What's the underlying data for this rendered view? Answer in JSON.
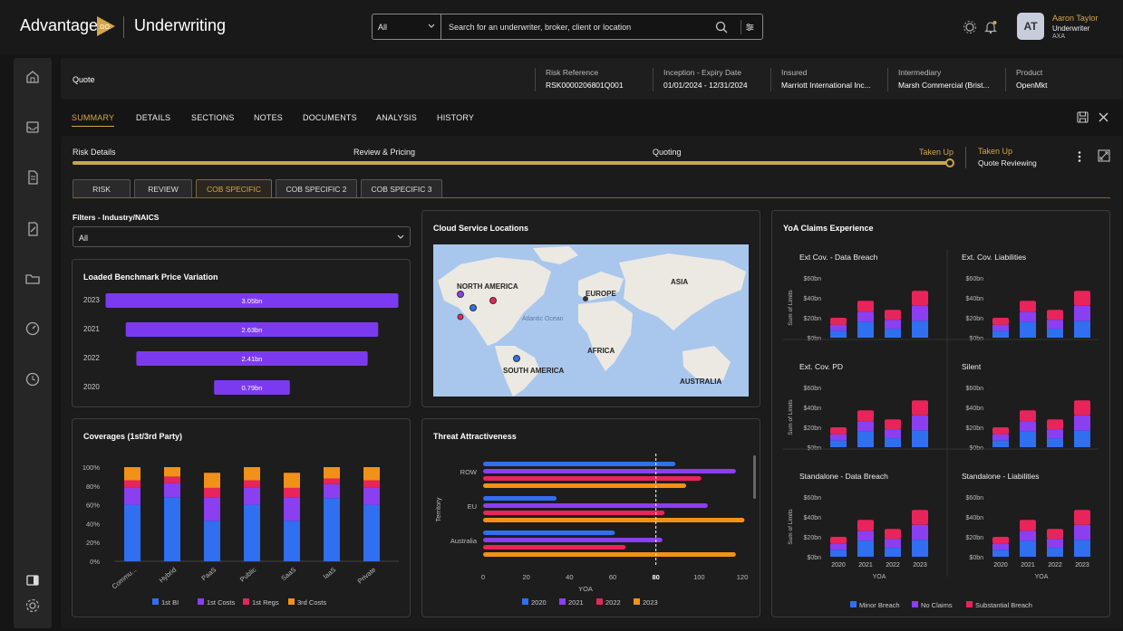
{
  "app": {
    "logo": "Advantage",
    "logo_mark": "GO",
    "name": "Underwriting"
  },
  "search": {
    "scope": "All",
    "placeholder": "Search for an underwriter, broker, client or location"
  },
  "user": {
    "initials": "AT",
    "name": "Aaron Taylor",
    "role": "Underwriter",
    "org": "AXA"
  },
  "header": {
    "page": "Quote",
    "fields": [
      {
        "label": "Risk Reference",
        "value": "RSK0000206801Q001"
      },
      {
        "label": "Inception - Expiry Date",
        "value": "01/01/2024 - 12/31/2024"
      },
      {
        "label": "Insured",
        "value": "Marriott International Inc..."
      },
      {
        "label": "Intermediary",
        "value": "Marsh Commercial (Brist..."
      },
      {
        "label": "Product",
        "value": "OpenMkt"
      }
    ]
  },
  "tabs": [
    "SUMMARY",
    "DETAILS",
    "SECTIONS",
    "NOTES",
    "DOCUMENTS",
    "ANALYSIS",
    "HISTORY"
  ],
  "stages": [
    "Risk Details",
    "Review & Pricing",
    "Quoting",
    "Taken Up"
  ],
  "status": {
    "label": "Taken Up",
    "value": "Quote Reviewing"
  },
  "subtabs": [
    "RISK",
    "REVIEW",
    "COB SPECIFIC",
    "COB SPECIFIC 2",
    "COB SPECIFIC 3"
  ],
  "filter": {
    "label": "Filters - Industry/NAICS",
    "value": "All"
  },
  "colors": {
    "accent": "#d4a64a",
    "blue": "#2f6ff0",
    "purple": "#8a3ff0",
    "red": "#e8245a",
    "orange": "#f29118",
    "bar": "#7c3af0"
  },
  "benchmark": {
    "title": "Loaded Benchmark Price Variation",
    "chart_data": {
      "type": "bar",
      "orientation": "horizontal",
      "categories": [
        "2023",
        "2021",
        "2022",
        "2020"
      ],
      "labels": [
        "3.05bn",
        "2.63bn",
        "2.41bn",
        "0.79bn"
      ],
      "values": [
        3.05,
        2.63,
        2.41,
        0.79
      ]
    }
  },
  "map": {
    "title": "Cloud Service Locations",
    "labels": [
      "NORTH AMERICA",
      "EUROPE",
      "ASIA",
      "Atlantic Ocean",
      "AFRICA",
      "SOUTH AMERICA",
      "AUSTRALIA"
    ]
  },
  "coverages": {
    "title": "Coverages (1st/3rd Party)",
    "chart_data": {
      "type": "bar",
      "stacked": true,
      "categories": [
        "Commu...",
        "Hybrid",
        "PaaS",
        "Public",
        "SaaS",
        "IaaS",
        "Private"
      ],
      "yticks": [
        "100%",
        "80%",
        "60%",
        "40%",
        "20%",
        "0%"
      ],
      "series": [
        {
          "name": "1st BI",
          "values": [
            60,
            68,
            43,
            60,
            43,
            67,
            60
          ]
        },
        {
          "name": "1st Costs",
          "values": [
            18,
            15,
            25,
            18,
            25,
            15,
            18
          ]
        },
        {
          "name": "1st Regs",
          "values": [
            8,
            7,
            10,
            8,
            10,
            6,
            8
          ]
        },
        {
          "name": "3rd Costs",
          "values": [
            14,
            10,
            16,
            14,
            16,
            12,
            14
          ]
        }
      ]
    }
  },
  "threat": {
    "title": "Threat Attractiveness",
    "chart_data": {
      "type": "bar",
      "orientation": "horizontal",
      "categories": [
        "ROW",
        "EU",
        "Australia"
      ],
      "xlabel": "YOA",
      "ylabel": "Territory",
      "xlim": [
        0,
        120
      ],
      "xticks": [
        "0",
        "20",
        "40",
        "60",
        "80",
        "100",
        "120"
      ],
      "marker_label": "80",
      "series": [
        {
          "name": "2020",
          "values": [
            89,
            34,
            61
          ]
        },
        {
          "name": "2021",
          "values": [
            117,
            104,
            83
          ]
        },
        {
          "name": "2022",
          "values": [
            101,
            84,
            66
          ]
        },
        {
          "name": "2023",
          "values": [
            94,
            121,
            117
          ]
        }
      ]
    }
  },
  "claims": {
    "title": "YoA Claims Experience",
    "yticks": [
      "$60bn",
      "$40bn",
      "$20bn",
      "$0bn"
    ],
    "ylabel": "Sum of Limits",
    "xaxis": "YOA",
    "legend": [
      "Minor Breach",
      "No Claims",
      "Substantial Breach"
    ],
    "chart_data": {
      "type": "bar",
      "stacked": true,
      "categories": [
        "2020",
        "2021",
        "2022",
        "2023"
      ],
      "panels": [
        {
          "title": "Ext Cov. - Data Breach",
          "minor": [
            7,
            16,
            9,
            17
          ],
          "noclaims": [
            6,
            10,
            9,
            15
          ],
          "substantial": [
            7,
            11,
            10,
            15
          ]
        },
        {
          "title": "Ext. Cov. Liabilities",
          "minor": [
            7,
            16,
            9,
            17
          ],
          "noclaims": [
            6,
            10,
            9,
            15
          ],
          "substantial": [
            7,
            11,
            10,
            15
          ]
        },
        {
          "title": "Ext. Cov. PD",
          "minor": [
            7,
            16,
            9,
            17
          ],
          "noclaims": [
            6,
            10,
            9,
            15
          ],
          "substantial": [
            7,
            11,
            10,
            15
          ]
        },
        {
          "title": "Silent",
          "minor": [
            7,
            16,
            9,
            17
          ],
          "noclaims": [
            6,
            10,
            9,
            15
          ],
          "substantial": [
            7,
            11,
            10,
            15
          ]
        },
        {
          "title": "Standalone - Data Breach",
          "minor": [
            7,
            16,
            9,
            17
          ],
          "noclaims": [
            6,
            10,
            9,
            15
          ],
          "substantial": [
            7,
            11,
            10,
            15
          ]
        },
        {
          "title": "Standalone - Liabilities",
          "minor": [
            7,
            16,
            9,
            17
          ],
          "noclaims": [
            6,
            10,
            9,
            15
          ],
          "substantial": [
            7,
            11,
            10,
            15
          ]
        }
      ]
    }
  }
}
